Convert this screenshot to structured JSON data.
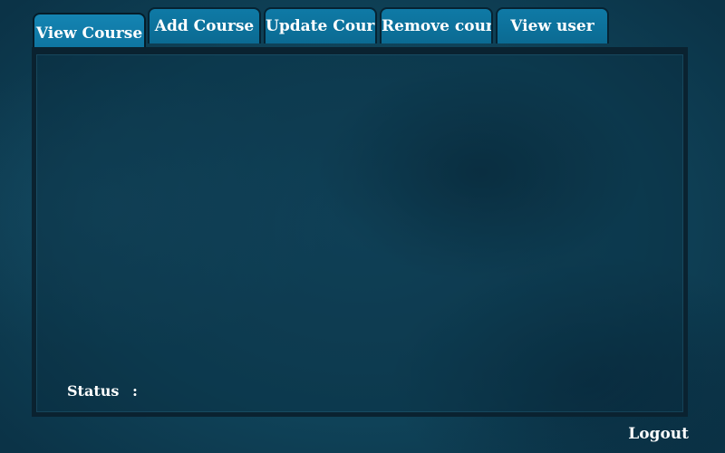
{
  "tabs": [
    {
      "label": "View Course",
      "active": true
    },
    {
      "label": "Add Course",
      "active": false
    },
    {
      "label": "Update Course",
      "active": false
    },
    {
      "label": "Remove course",
      "active": false
    },
    {
      "label": "View user",
      "active": false
    }
  ],
  "status": {
    "label": "Status",
    "separator": ":",
    "value": ""
  },
  "logout_label": "Logout",
  "colors": {
    "background": "#0f4258",
    "tab": "#0f7aa6",
    "tab_border": "#062333",
    "panel_border": "#0a2230",
    "text": "#ffffff"
  }
}
